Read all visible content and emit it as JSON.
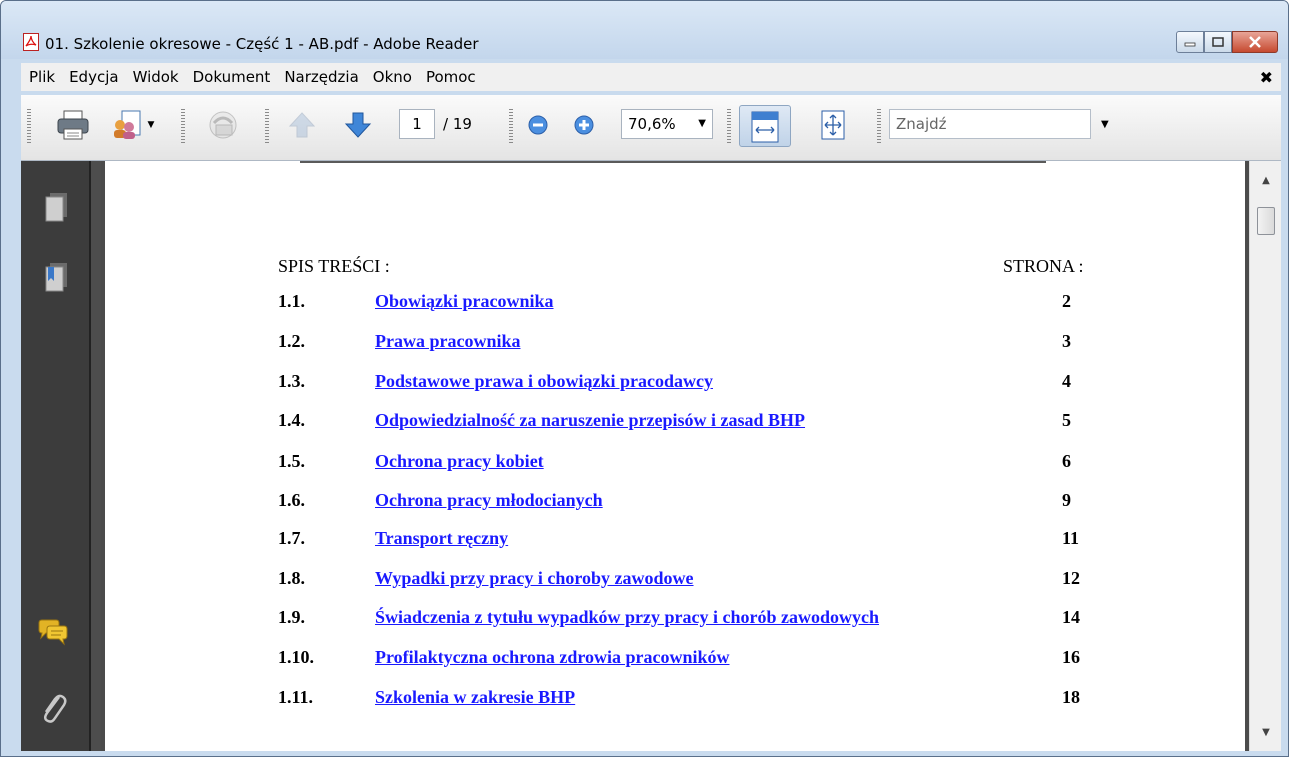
{
  "window": {
    "title": "01. Szkolenie okresowe - Część 1 - AB.pdf - Adobe Reader"
  },
  "menu": {
    "items": [
      "Plik",
      "Edycja",
      "Widok",
      "Dokument",
      "Narzędzia",
      "Okno",
      "Pomoc"
    ],
    "close_glyph": "✖"
  },
  "toolbar": {
    "page_current": "1",
    "page_total": "/ 19",
    "zoom": "70,6%",
    "find_placeholder": "Znajdź",
    "icons": [
      "print-icon",
      "share-icon",
      "collaborate-icon",
      "previous-page-icon",
      "next-page-icon",
      "zoom-out-icon",
      "zoom-in-icon",
      "fit-width-icon",
      "fit-page-icon"
    ]
  },
  "left_panel": {
    "icons": [
      "pages-icon",
      "bookmarks-icon",
      "comments-icon",
      "attachments-icon"
    ]
  },
  "document": {
    "heading_left": "SPIS TREŚCI :",
    "heading_right": "STRONA :",
    "entries": [
      {
        "num": "1.1.",
        "title": "Obowiązki pracownika",
        "page": "2"
      },
      {
        "num": "1.2.",
        "title": "Prawa pracownika",
        "page": "3"
      },
      {
        "num": "1.3.",
        "title": "Podstawowe prawa i obowiązki pracodawcy",
        "page": "4"
      },
      {
        "num": "1.4.",
        "title": "Odpowiedzialność za naruszenie przepisów i zasad BHP",
        "page": "5"
      },
      {
        "num": "1.5.",
        "title": "Ochrona pracy kobiet",
        "page": "6"
      },
      {
        "num": "1.6.",
        "title": "Ochrona pracy młodocianych",
        "page": "9"
      },
      {
        "num": "1.7.",
        "title": "Transport ręczny",
        "page": "11"
      },
      {
        "num": "1.8.",
        "title": "Wypadki przy pracy i choroby zawodowe",
        "page": "12"
      },
      {
        "num": "1.9.",
        "title": "Świadczenia z tytułu wypadków przy pracy i chorób zawodowych",
        "page": "14"
      },
      {
        "num": "1.10.",
        "title": "Profilaktyczna ochrona zdrowia pracowników",
        "page": "16"
      },
      {
        "num": "1.11.",
        "title": "Szkolenia w zakresie BHP",
        "page": "18"
      }
    ]
  },
  "colors": {
    "link": "#1a1aff",
    "panel": "#3c3c3c"
  }
}
